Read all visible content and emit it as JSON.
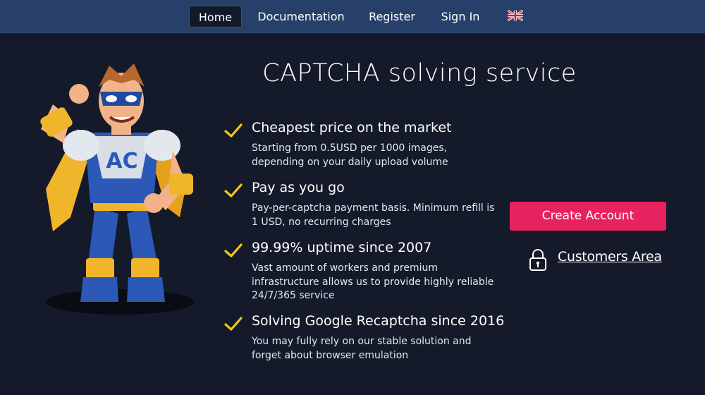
{
  "nav": {
    "items": [
      {
        "label": "Home",
        "active": true
      },
      {
        "label": "Documentation",
        "active": false
      },
      {
        "label": "Register",
        "active": false
      },
      {
        "label": "Sign In",
        "active": false
      }
    ],
    "language_icon": "uk-flag-icon"
  },
  "hero": {
    "title": "CAPTCHA solving service",
    "mascot_badge": "AC"
  },
  "features": [
    {
      "title": "Cheapest price on the market",
      "desc": "Starting from 0.5USD per 1000 images, depending on your daily upload volume"
    },
    {
      "title": "Pay as you go",
      "desc": "Pay-per-captcha payment basis. Minimum refill is 1 USD, no recurring charges"
    },
    {
      "title": "99.99% uptime since 2007",
      "desc": "Vast amount of workers and premium infrastructure allows us to provide highly reliable 24/7/365 service"
    },
    {
      "title": "Solving Google Recaptcha since 2016",
      "desc": "You may fully rely on our stable solution and forget about browser emulation"
    }
  ],
  "cta": {
    "create_account": "Create Account",
    "customers_area": "Customers Area"
  },
  "colors": {
    "background": "#141a29",
    "navbar": "#27406a",
    "accent": "#e6235f",
    "check": "#f2c81a"
  }
}
